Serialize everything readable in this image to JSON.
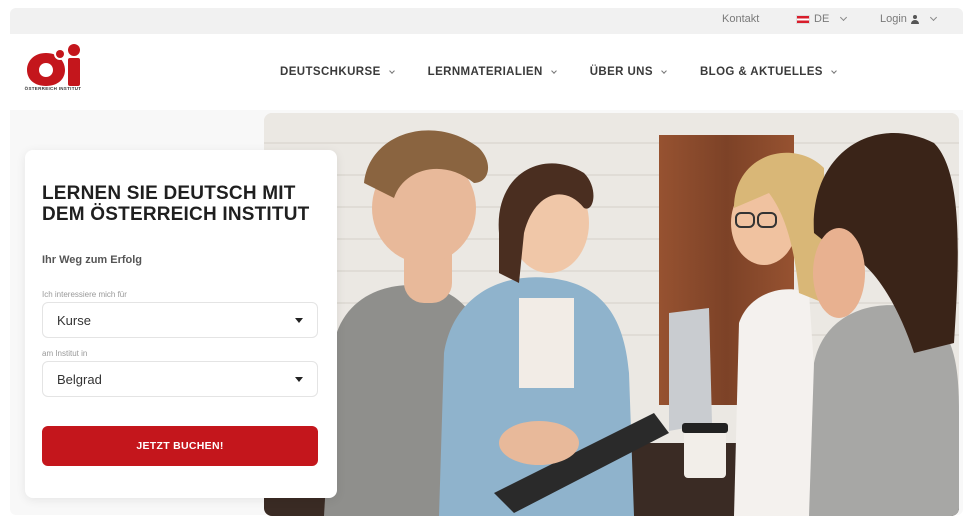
{
  "topbar": {
    "contact_label": "Kontakt",
    "language_code": "DE",
    "login_label": "Login"
  },
  "brand": {
    "logo_mark": "ÖI",
    "logo_text": "ÖSTERREICH INSTITUT",
    "accent_color": "#c4161c"
  },
  "nav": {
    "items": [
      {
        "label": "DEUTSCHKURSE"
      },
      {
        "label": "LERNMATERIALIEN"
      },
      {
        "label": "ÜBER UNS"
      },
      {
        "label": "BLOG & AKTUELLES"
      }
    ]
  },
  "booking_form": {
    "title": "LERNEN SIE DEUTSCH MIT DEM ÖSTERREICH INSTITUT",
    "subtitle": "Ihr Weg zum Erfolg",
    "interest_label": "Ich interessiere mich für",
    "interest_value": "Kurse",
    "location_label": "am Institut in",
    "location_value": "Belgrad",
    "submit_label": "JETZT BUCHEN!"
  },
  "hero": {
    "image_subject": "four-students-laughing-at-table-photo"
  }
}
